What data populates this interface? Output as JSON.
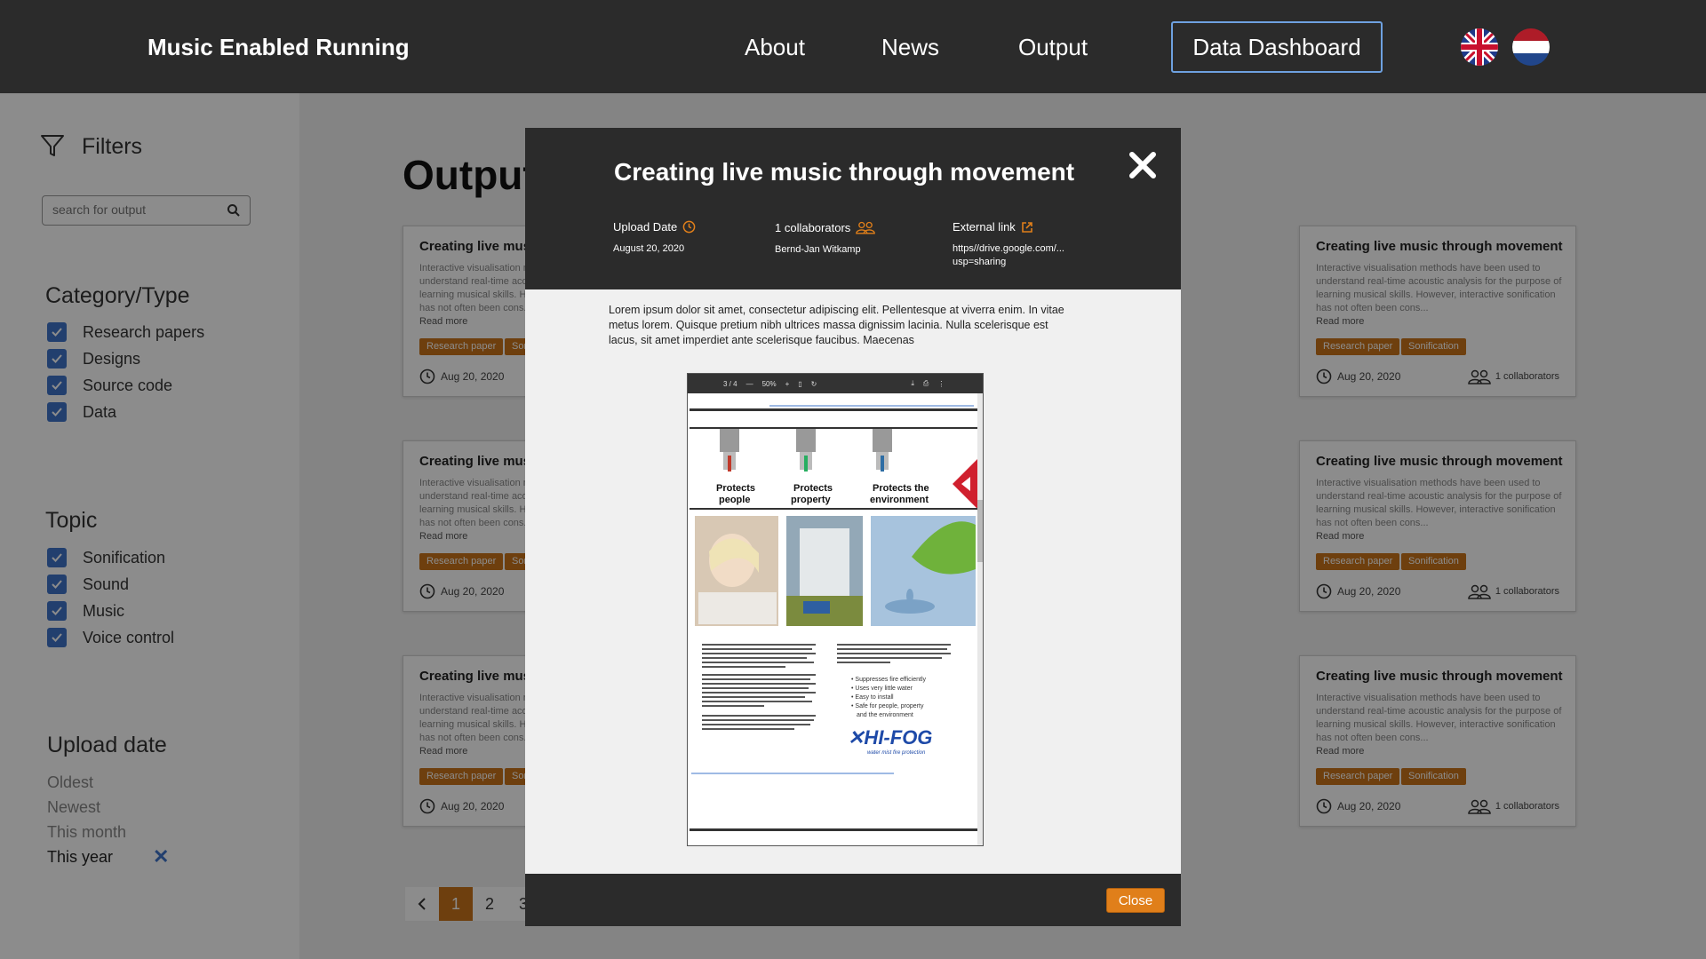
{
  "header": {
    "brand": "Music Enabled Running",
    "nav": [
      "About",
      "News",
      "Output"
    ],
    "dashboard_label": "Data Dashboard"
  },
  "sidebar": {
    "filters_title": "Filters",
    "search_placeholder": "search for output",
    "category_title": "Category/Type",
    "categories": [
      "Research papers",
      "Designs",
      "Source code",
      "Data"
    ],
    "topic_title": "Topic",
    "topics": [
      "Sonification",
      "Sound",
      "Music",
      "Voice control"
    ],
    "upload_title": "Upload date",
    "upload_options": [
      "Oldest",
      "Newest",
      "This month",
      "This year"
    ]
  },
  "main": {
    "title": "Output",
    "card": {
      "title": "Creating live music through movement",
      "desc": "Interactive visualisation methods have been used to understand real-time acoustic analysis for the purpose of learning musical skills. However, interactive sonification has not often been cons...",
      "more": "Read more",
      "tag1": "Research paper",
      "tag2": "Sonification",
      "date": "Aug 20, 2020",
      "collab": "1 collaborators"
    },
    "pages": [
      "1",
      "2",
      "3"
    ]
  },
  "modal": {
    "title": "Creating live music through movement",
    "upload_label": "Upload Date",
    "upload_value": "August 20, 2020",
    "collab_label": "1 collaborators",
    "collab_value": "Bernd-Jan Witkamp",
    "link_label": "External link",
    "link_value": "https//drive.google.com/...",
    "link_value2": "usp=sharing",
    "body": "Lorem ipsum dolor sit amet, consectetur adipiscing elit. Pellentesque at viverra enim. In vitae metus lorem. Quisque pretium nibh ultrices massa dignissim lacinia. Nulla scelerisque est lacus, sit amet imperdiet ante scelerisque faucibus. Maecenas",
    "close_label": "Close",
    "viewer": {
      "page_indicator": "3 / 4",
      "zoom": "50%",
      "captions": [
        "Protects people",
        "Protects property",
        "Protects the environment"
      ],
      "col1_text": "In suppressing a fire, traditional low-pressure sprinkler and deluge systems often cause significant water damage that can be greater than the damage caused by the fire itself. Such systems can also be difficult to install, especially in retrofit projects.",
      "col1_text2": "Traditional gas-based systems are unsuitable for many high-risk areas because of the difficulty involved in guaranteeing enclosure integrity, high recharge costs and personal and environmental safety issues. Traditional foam-based systems cause collateral damage and present the problem of toxic run-off to municipal sewage systems.",
      "col1_text3": "HI-FOG offers equivalent or better fire suppression than traditional systems with minimal water discharge, minimizing damage to property and reducing the time and cost of clean-up.",
      "col2_text": "HI-FOG tubes are small in diameter, making installation fast and easy especially in retrofits. Finally, HI-FOG uses pure and potable water: it is totally safe for people, property and the environment.",
      "bullets": [
        "Suppresses fire efficiently",
        "Uses very little water",
        "Easy to install",
        "Safe for people, property and the environment"
      ],
      "logo": "HI-FOG",
      "logo_sub": "water mist fire protection"
    }
  }
}
